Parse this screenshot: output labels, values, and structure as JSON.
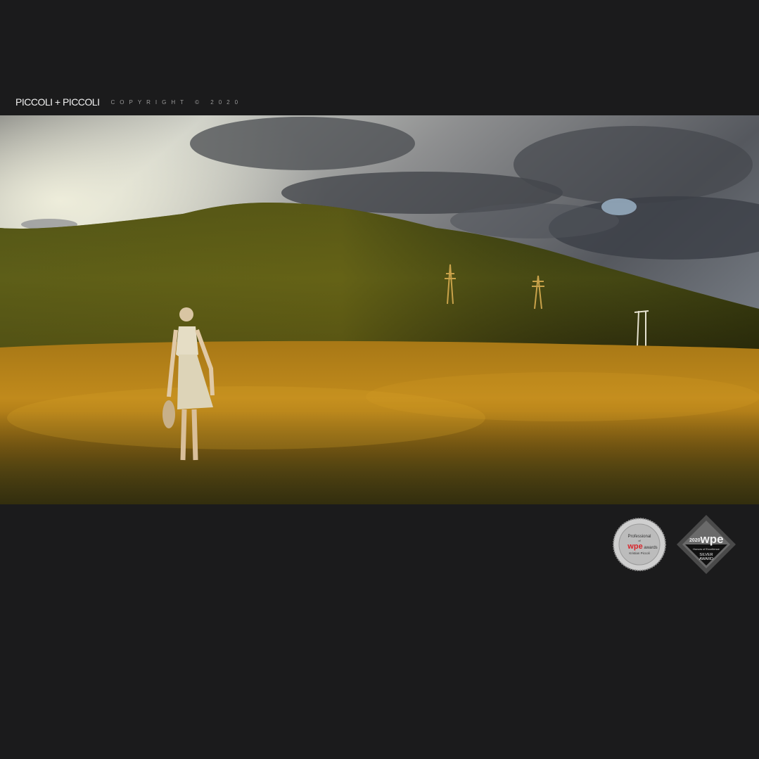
{
  "header": {
    "brand": "PICCOLI + PICCOLI",
    "copyright": "COPYRIGHT © 2020"
  },
  "photo": {
    "subject": "woman-in-dress-in-field-icon"
  },
  "badges": {
    "professional": {
      "line1": "Professional",
      "line2": "of",
      "logo": "wpe",
      "logo_suffix": "awards",
      "name": "Kristian Piccoli"
    },
    "silver": {
      "year": "2020",
      "logo": "wpe",
      "line1": "Honors of Excellence",
      "line2": "SILVER",
      "line3": "AWARD"
    }
  },
  "colors": {
    "background": "#1b1b1c",
    "accent_red": "#d8262c"
  }
}
